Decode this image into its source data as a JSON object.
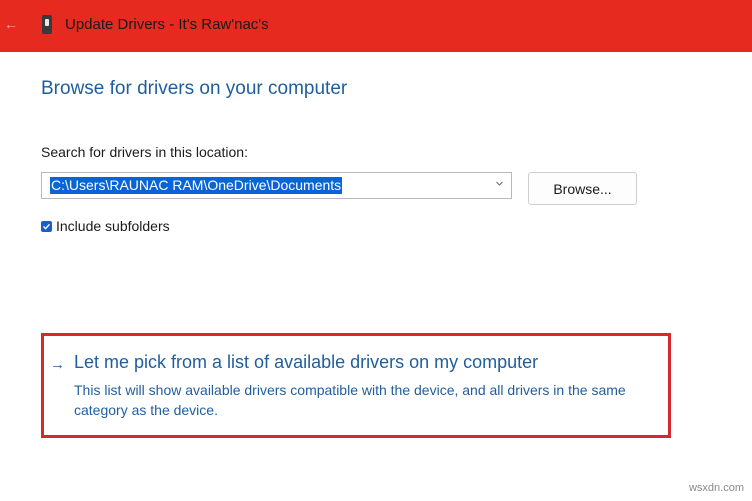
{
  "window": {
    "title": "Update Drivers - It's Raw'nac's",
    "back_icon": "back-arrow-icon",
    "device_icon": "device-icon"
  },
  "main": {
    "heading": "Browse for drivers on your computer",
    "search_label": "Search for drivers in this location:",
    "location_value": "C:\\Users\\RAUNAC RAM\\OneDrive\\Documents",
    "browse_label": "Browse...",
    "include_subfolders_label": "Include subfolders",
    "include_subfolders_checked": true
  },
  "pick_option": {
    "arrow": "→",
    "title": "Let me pick from a list of available drivers on my computer",
    "description": "This list will show available drivers compatible with the device, and all drivers in the same category as the device."
  },
  "watermark": "wsxdn.com",
  "colors": {
    "titlebar": "#e62a1f",
    "link_blue": "#1f5e9e",
    "highlight": "#0a64d6",
    "annotation_red": "#d3292f"
  }
}
